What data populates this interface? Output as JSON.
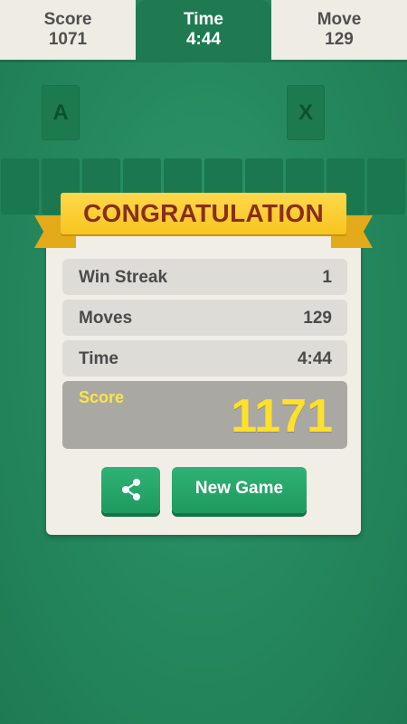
{
  "header": {
    "score": {
      "label": "Score",
      "value": "1071"
    },
    "time": {
      "label": "Time",
      "value": "4:44"
    },
    "move": {
      "label": "Move",
      "value": "129"
    }
  },
  "foundations": [
    {
      "label": "A"
    },
    {
      "label": "X"
    }
  ],
  "dialog": {
    "title": "CONGRATULATION",
    "stats": [
      {
        "label": "Win Streak",
        "value": "1"
      },
      {
        "label": "Moves",
        "value": "129"
      },
      {
        "label": "Time",
        "value": "4:44"
      }
    ],
    "score": {
      "label": "Score",
      "value": "1171"
    },
    "share_icon": "share-icon",
    "new_game_label": "New Game"
  },
  "colors": {
    "felt": "#268a5f",
    "ribbon": "#f7c51f",
    "title_text": "#8a2d1a",
    "score_text": "#ffe02a",
    "button": "#1f9a5f"
  }
}
